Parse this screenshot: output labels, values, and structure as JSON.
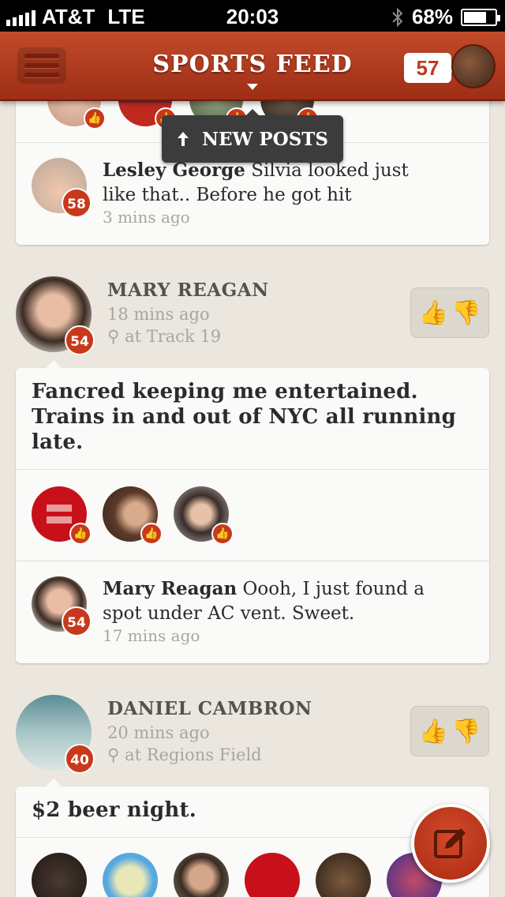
{
  "status_bar": {
    "carrier": "AT&T",
    "network": "LTE",
    "time": "20:03",
    "battery": "68%"
  },
  "nav": {
    "title": "SPORTS FEED",
    "count": "57"
  },
  "new_posts_label": "NEW POSTS",
  "top_comment": {
    "name": "Lesley George",
    "text": "Silvia looked just like that.. Before he got hit",
    "time": "3 mins ago",
    "badge": "58"
  },
  "posts": [
    {
      "author": "MARY REAGAN",
      "time": "18 mins ago",
      "location": "at Track 19",
      "badge": "54",
      "text": "Fancred keeping me entertained. Trains in and out of NYC all running late.",
      "comment": {
        "name": "Mary Reagan",
        "text": "Oooh, I just found a spot under AC vent. Sweet.",
        "time": "17 mins ago",
        "badge": "54"
      }
    },
    {
      "author": "DANIEL CAMBRON",
      "time": "20 mins ago",
      "location": "at Regions Field",
      "badge": "40",
      "text": "$2 beer night."
    }
  ]
}
